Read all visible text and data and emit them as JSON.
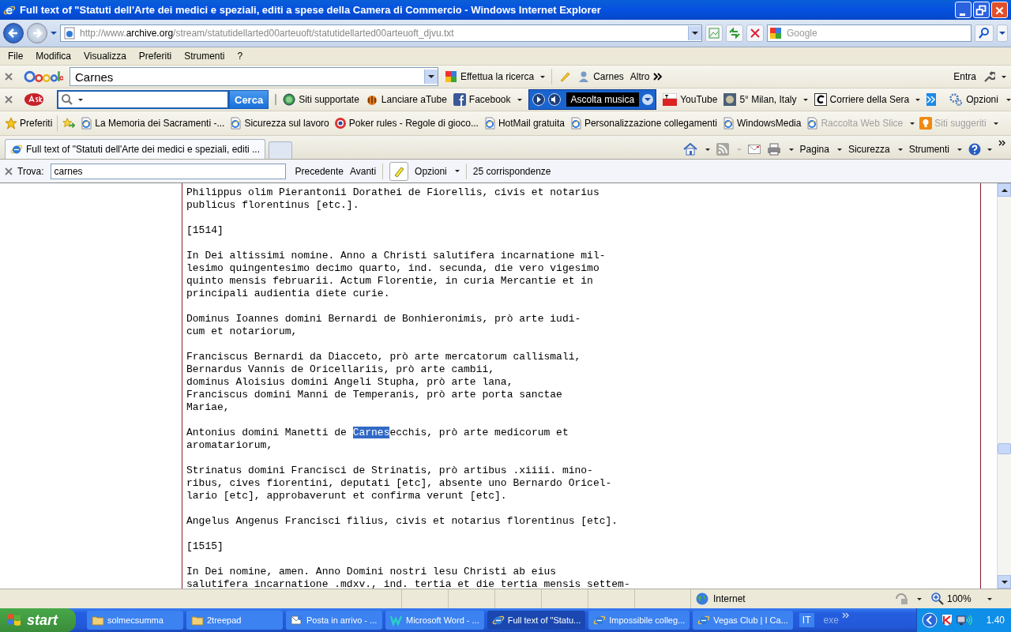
{
  "window": {
    "title": "Full text of \"Statuti dell'Arte dei medici e speziali, editi a spese della Camera di Commercio  - Windows Internet Explorer"
  },
  "address_bar": {
    "url_prefix": "http://www.",
    "domain": "archive.org",
    "url_path": "/stream/statutidellarted00arteuoft/statutidellarted00arteuoft_djvu.txt"
  },
  "search": {
    "placeholder": "Google"
  },
  "menu": [
    "File",
    "Modifica",
    "Visualizza",
    "Preferiti",
    "Strumenti",
    "?"
  ],
  "google_toolbar": {
    "query": "Carnes",
    "search_button": "Effettua la ricerca",
    "profile": "Carnes",
    "more": "Altro",
    "sign_in": "Entra"
  },
  "ask_toolbar": {
    "search_button": "Cerca",
    "items": [
      {
        "kind": "globe",
        "label": "Siti supportate",
        "dropdown": false
      },
      {
        "kind": "atube",
        "label": "Lanciare aTube",
        "dropdown": false
      },
      {
        "kind": "facebook",
        "label": "Facebook",
        "dropdown": true
      },
      {
        "kind": "music",
        "label": "Ascolta musica",
        "dropdown": true
      },
      {
        "kind": "youtube",
        "label": "YouTube",
        "dropdown": false
      },
      {
        "kind": "weather",
        "label": "5° Milan, Italy",
        "dropdown": true
      },
      {
        "kind": "news",
        "label": "Corriere della Sera",
        "dropdown": true
      },
      {
        "kind": "more"
      }
    ],
    "options": "Opzioni"
  },
  "favorites_bar": {
    "label": "Preferiti",
    "links": [
      {
        "kind": "page",
        "label": "La Memoria dei Sacramenti -...",
        "disabled": false,
        "dropdown": false
      },
      {
        "kind": "page",
        "label": "Sicurezza sul lavoro",
        "disabled": false,
        "dropdown": false
      },
      {
        "kind": "poker",
        "label": "Poker rules - Regole di gioco...",
        "disabled": false,
        "dropdown": false
      },
      {
        "kind": "page",
        "label": "HotMail gratuita",
        "disabled": false,
        "dropdown": false
      },
      {
        "kind": "page",
        "label": "Personalizzazione collegamenti",
        "disabled": false,
        "dropdown": false
      },
      {
        "kind": "page",
        "label": "WindowsMedia",
        "disabled": false,
        "dropdown": false
      },
      {
        "kind": "page",
        "label": "Raccolta Web Slice",
        "disabled": true,
        "dropdown": true
      },
      {
        "kind": "bulb",
        "label": "Siti suggeriti",
        "disabled": true,
        "dropdown": true
      }
    ]
  },
  "tabs": [
    {
      "title": "Full text of \"Statuti dell'Arte dei medici e speziali, editi ...",
      "selected": true
    }
  ],
  "command_bar": [
    "Pagina",
    "Sicurezza",
    "Strumenti"
  ],
  "find_bar": {
    "label": "Trova:",
    "value": "carnes",
    "previous": "Precedente",
    "next": "Avanti",
    "options": "Opzioni",
    "matches": "25 corrispondenze"
  },
  "document": {
    "paragraphs": [
      [
        "Philippus olim Pierantonii Dorathei de Fiorellis, civis et notarius",
        "publicus florentinus [etc.]."
      ],
      [
        "[1514]"
      ],
      [
        "In Dei altissimi nomine. Anno a Christi salutifera incarnatione mil-",
        "lesimo quingentesimo decimo quarto, ind. secunda, die vero vigesimo",
        "quinto mensis februarii. Actum Florentie, in curia Mercantie et in",
        "principali audientia diete curie."
      ],
      [
        "Dominus Ioannes domini Bernardi de Bonhieronimis, prò arte iudi-",
        "cum et notariorum,"
      ],
      [
        "Franciscus Bernardi da Diacceto, prò arte mercatorum callismali,",
        "Bernardus Vannis de Oricellariis, prò arte cambii,",
        "dominus Aloisius domini Angeli Stupha, prò arte lana,",
        "Franciscus domini Manni de Temperanis, prò arte porta sanctae",
        "Mariae,"
      ],
      [
        {
          "segments": [
            {
              "text": "Antonius domini Manetti de ",
              "highlighted": false
            },
            {
              "text": "Carnes",
              "highlighted": true
            },
            {
              "text": "ecchis, prò arte medicorum et",
              "highlighted": false
            }
          ]
        },
        "aromatariorum,"
      ],
      [
        "Strinatus domini Francisci de Strinatis, prò artibus .xiiii. mino-",
        "ribus, cives fiorentini, deputati [etc], absente uno Bernardo Oricel-",
        "lario [etc], approbaverunt et confirma verunt [etc]."
      ],
      [
        "Angelus Angenus Francisci fìlius, civis et notarius florentinus [etc]."
      ],
      [
        "[1515]"
      ],
      [
        "In Dei nomine, amen. Anno Domini nostri lesu Christi ab eius",
        "salutifera incarnatione .mdxv., ind. tertia et die tertia mensis settem-"
      ]
    ]
  },
  "status_bar": {
    "zone": "Internet",
    "zoom": "100%"
  },
  "taskbar": {
    "start": "start",
    "tasks": [
      {
        "kind": "folder",
        "label": "solmecsumma",
        "selected": false
      },
      {
        "kind": "folder",
        "label": "2treepad",
        "selected": false
      },
      {
        "kind": "mail",
        "label": "Posta in arrivo - ...",
        "selected": false
      },
      {
        "kind": "word",
        "label": "Microsoft Word - ...",
        "selected": false
      },
      {
        "kind": "ie",
        "label": "Full text of \"Statu...",
        "selected": true
      },
      {
        "kind": "ie",
        "label": "Impossibile colleg...",
        "selected": false
      },
      {
        "kind": "ie",
        "label": "Vegas Club | I Ca...",
        "selected": false
      }
    ],
    "language": "IT",
    "program": "exe",
    "clock": "1.40"
  }
}
